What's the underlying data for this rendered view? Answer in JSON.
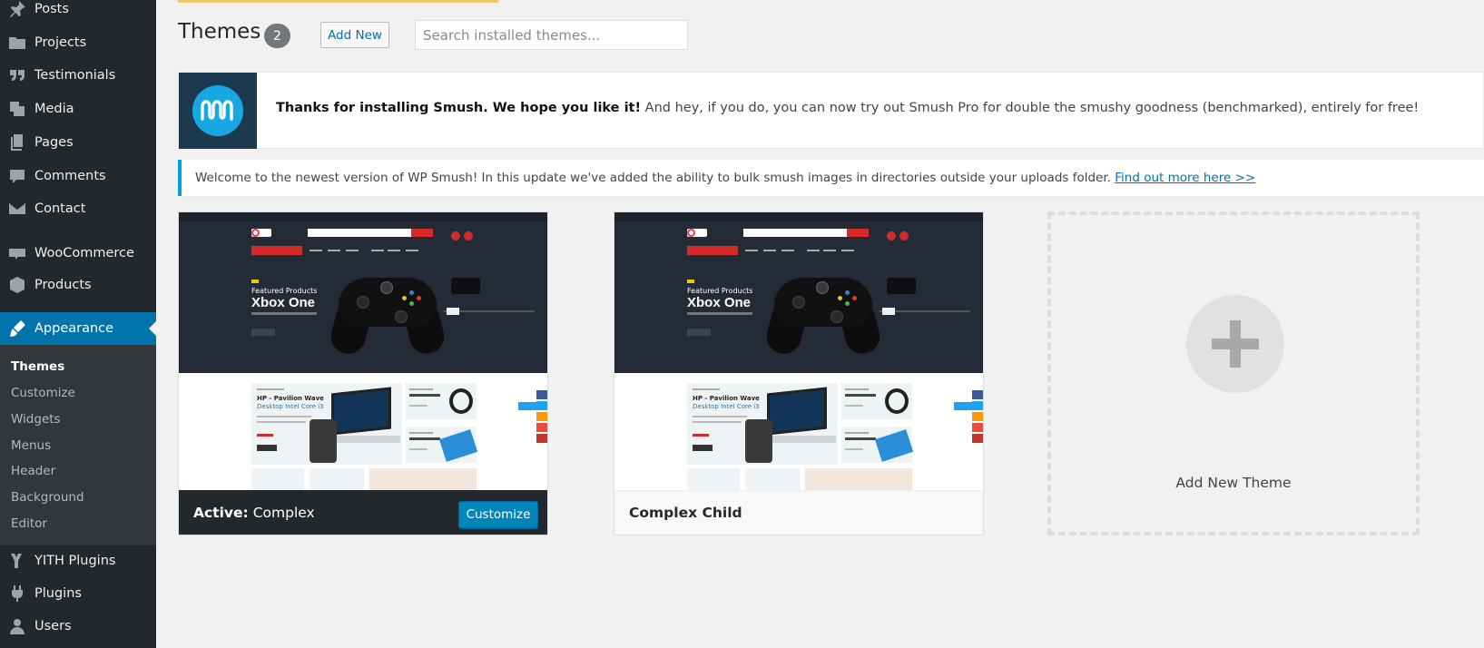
{
  "sidebar": {
    "items": [
      {
        "label": "Posts",
        "icon": "pin-icon"
      },
      {
        "label": "Projects",
        "icon": "folder-icon"
      },
      {
        "label": "Testimonials",
        "icon": "quote-icon"
      },
      {
        "label": "Media",
        "icon": "media-icon"
      },
      {
        "label": "Pages",
        "icon": "pages-icon"
      },
      {
        "label": "Comments",
        "icon": "comment-icon"
      },
      {
        "label": "Contact",
        "icon": "mail-icon"
      },
      {
        "label": "WooCommerce",
        "icon": "woo-icon"
      },
      {
        "label": "Products",
        "icon": "box-icon"
      },
      {
        "label": "Appearance",
        "icon": "brush-icon"
      },
      {
        "label": "YITH Plugins",
        "icon": "yith-icon"
      },
      {
        "label": "Plugins",
        "icon": "plug-icon"
      },
      {
        "label": "Users",
        "icon": "user-icon"
      }
    ],
    "submenu": [
      "Themes",
      "Customize",
      "Widgets",
      "Menus",
      "Header",
      "Background",
      "Editor"
    ],
    "active_submenu": "Themes"
  },
  "header": {
    "title": "Themes",
    "count": "2",
    "add_new": "Add New",
    "search_placeholder": "Search installed themes..."
  },
  "smush_notice": {
    "bold": "Thanks for installing Smush. We hope you like it!",
    "text": " And hey, if you do, you can now try out Smush Pro for double the smushy goodness (benchmarked), entirely for free!"
  },
  "update_notice": {
    "text": "Welcome to the newest version of WP Smush! In this update we've added the ability to bulk smush images in directories outside your uploads folder. ",
    "link": "Find out more here >>"
  },
  "themes": [
    {
      "name": "Complex",
      "active_label": "Active:",
      "customize": "Customize",
      "shot_text1": "Featured Products",
      "shot_text2": "Xbox One",
      "card_title": "HP - Pavilion Wave",
      "card_sub": "Desktop Intel Core i3"
    },
    {
      "name": "Complex Child",
      "shot_text1": "Featured Products",
      "shot_text2": "Xbox One",
      "card_title": "HP - Pavilion Wave",
      "card_sub": "Desktop Intel Core i3"
    }
  ],
  "add_new_theme": "Add New Theme",
  "colors": {
    "sidebar_bg": "#23282d",
    "accent": "#0073aa",
    "notice_border": "#00a0d2",
    "button_primary": "#0085ba"
  }
}
